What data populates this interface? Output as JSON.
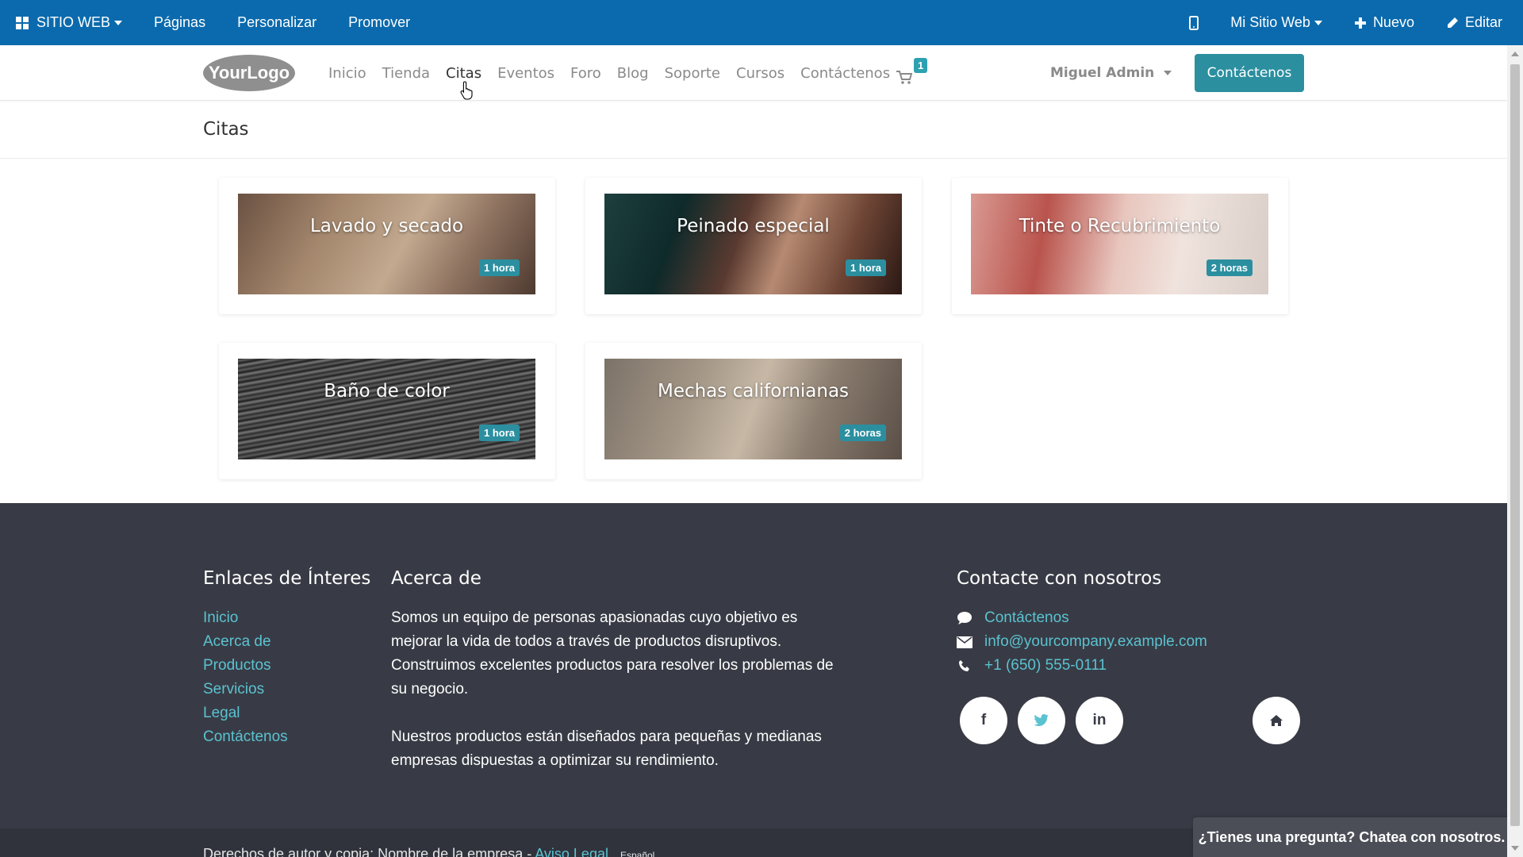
{
  "adminbar": {
    "brand": "SITIO WEB",
    "menu": [
      "Páginas",
      "Personalizar",
      "Promover"
    ],
    "site": "Mi Sitio Web",
    "new": "Nuevo",
    "edit": "Editar"
  },
  "header": {
    "logo_text": "YourLogo",
    "nav": [
      "Inicio",
      "Tienda",
      "Citas",
      "Eventos",
      "Foro",
      "Blog",
      "Soporte",
      "Cursos",
      "Contáctenos"
    ],
    "cart_count": "1",
    "user": "Miguel Admin",
    "cta": "Contáctenos"
  },
  "page": {
    "title": "Citas"
  },
  "appointments": [
    {
      "title": "Lavado y secado",
      "duration": "1 hora"
    },
    {
      "title": "Peinado especial",
      "duration": "1 hora"
    },
    {
      "title": "Tinte o Recubrimiento",
      "duration": "2 horas"
    },
    {
      "title": "Baño de color",
      "duration": "1 hora"
    },
    {
      "title": "Mechas californianas",
      "duration": "2 horas"
    }
  ],
  "footer": {
    "links_title": "Enlaces de Ínteres",
    "links": [
      "Inicio",
      "Acerca de",
      "Productos",
      "Servicios",
      "Legal",
      "Contáctenos"
    ],
    "about_title": "Acerca de",
    "about_p1": "Somos un equipo de personas apasionadas cuyo objetivo es mejorar la vida de todos a través de productos disruptivos. Construimos excelentes productos para resolver los problemas de su negocio.",
    "about_p2": "Nuestros productos están diseñados para pequeñas y medianas empresas dispuestas a optimizar su rendimiento.",
    "contact_title": "Contacte con nosotros",
    "contact_link": "Contáctenos",
    "email": "info@yourcompany.example.com",
    "phone": "+1 (650) 555-0111",
    "social": {
      "facebook": "f",
      "linkedin": "in"
    }
  },
  "copyright": {
    "text": "Derechos de autor y copia: Nombre de la empresa",
    "legal": "Aviso Legal",
    "lang": "Español"
  },
  "chat": "¿Tienes una pregunta? Chatea con nosotros.",
  "colors": {
    "adminbar": "#0b6aad",
    "accent": "#2b8fa0",
    "footer": "#383b45",
    "link": "#5bc2d1"
  }
}
